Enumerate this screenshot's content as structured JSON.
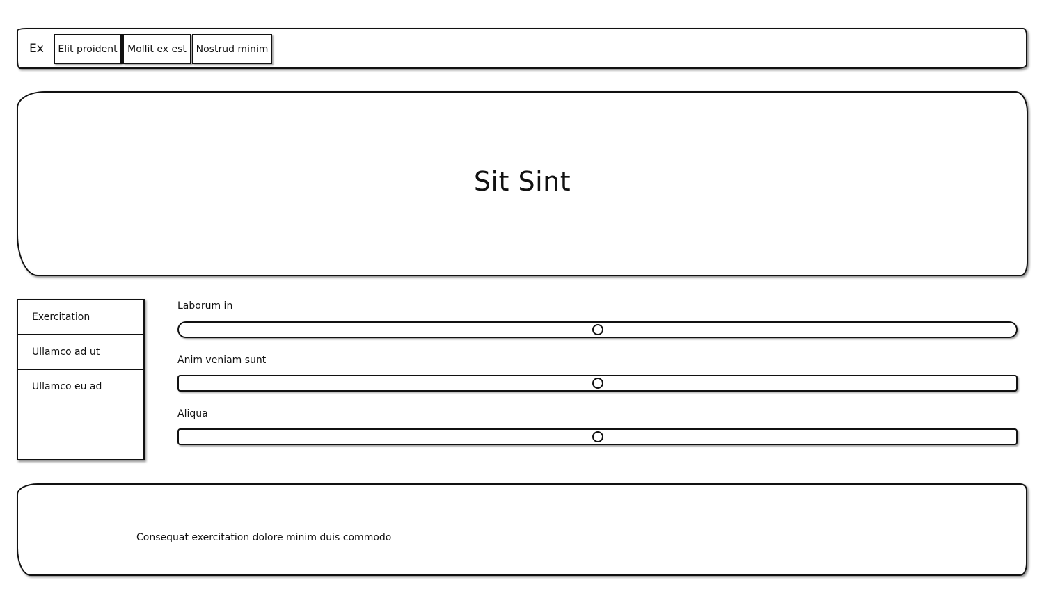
{
  "navbar": {
    "brand": "Ex",
    "buttons": [
      "Elit proident",
      "Mollit ex est",
      "Nostrud minim"
    ]
  },
  "hero": {
    "title": "Sit Sint"
  },
  "side_menu": {
    "items": [
      "Exercitation",
      "Ullamco ad ut",
      "Ullamco eu ad"
    ]
  },
  "sliders": [
    {
      "label": "Laborum in",
      "value_fraction": 0.5
    },
    {
      "label": "Anim veniam sunt",
      "value_fraction": 0.5
    },
    {
      "label": "Aliqua",
      "value_fraction": 0.5
    }
  ],
  "footer": {
    "text": "Consequat exercitation dolore minim duis commodo"
  }
}
